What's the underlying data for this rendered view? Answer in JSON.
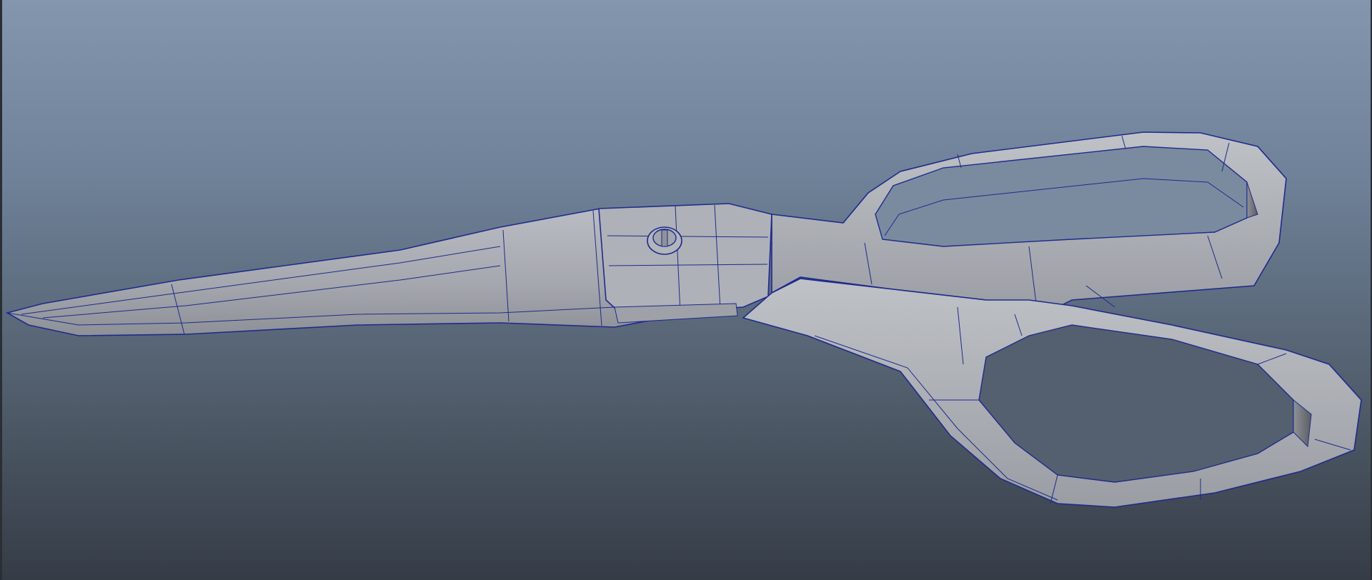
{
  "viewport": {
    "panel": "perspective",
    "display_mode": "wireframe-on-shaded",
    "object": "scissors-mesh"
  },
  "colors": {
    "background_top": "#8396ad",
    "background_bottom": "#353c46",
    "mesh_fill": "#a9acb2",
    "mesh_shadow": "#6f7378",
    "wireframe": "#1f2a8c"
  }
}
